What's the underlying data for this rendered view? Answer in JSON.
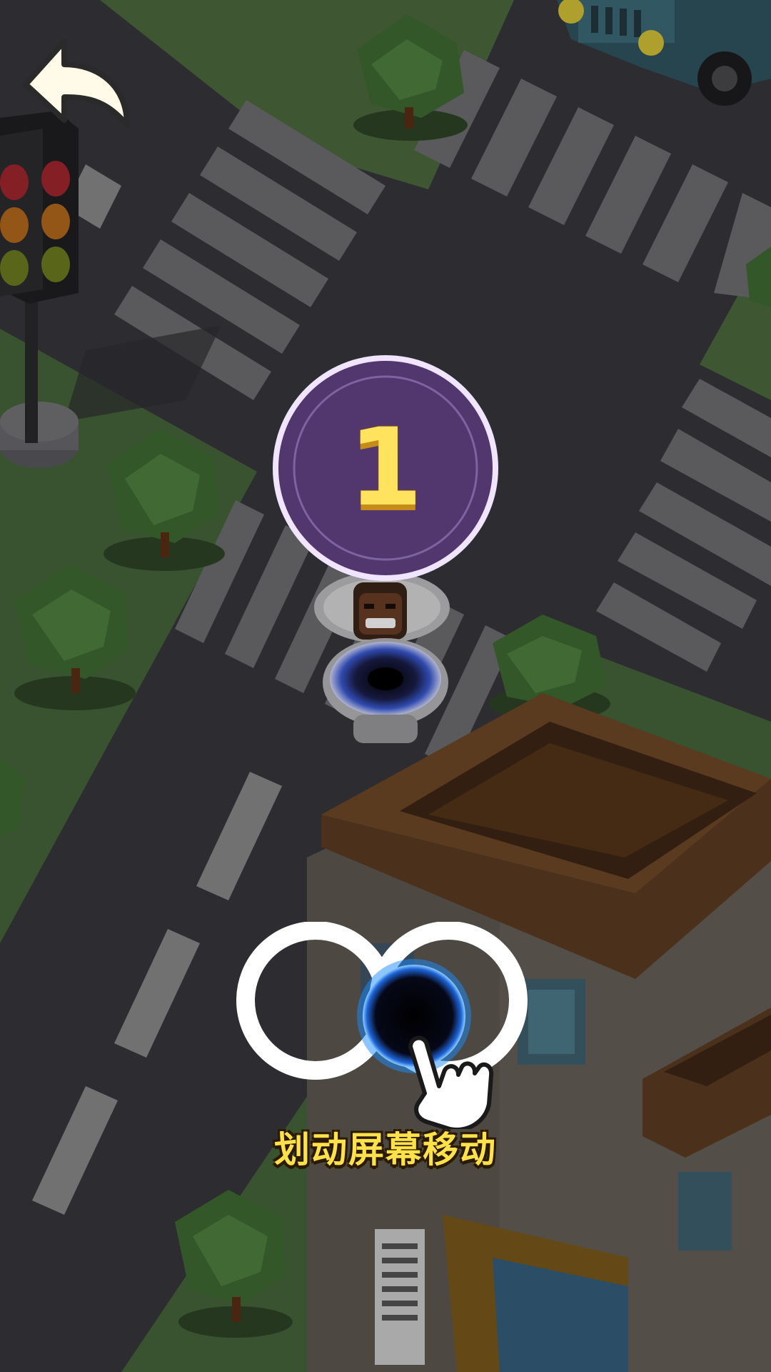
{
  "game": {
    "level_number": "1",
    "swipe_hint": "划动屏幕移动"
  },
  "icons": {
    "back": "back-arrow-icon",
    "traffic_light": "traffic-light",
    "swipe_gesture": "infinity-swipe-gesture-icon",
    "hand": "pointing-hand-icon",
    "player": "black-hole-toilet"
  },
  "colors": {
    "road": "#3a3a3f",
    "grass": "#4b6b3e",
    "crosswalk": "#7a7a7c",
    "building_roof": "#5b3b22",
    "badge_fill": "#51386f",
    "badge_ring": "#e9d8ff",
    "level_text": "#ffe25e",
    "hint_text": "#ffe14a",
    "black_hole_glow": "#2c7bf0"
  }
}
